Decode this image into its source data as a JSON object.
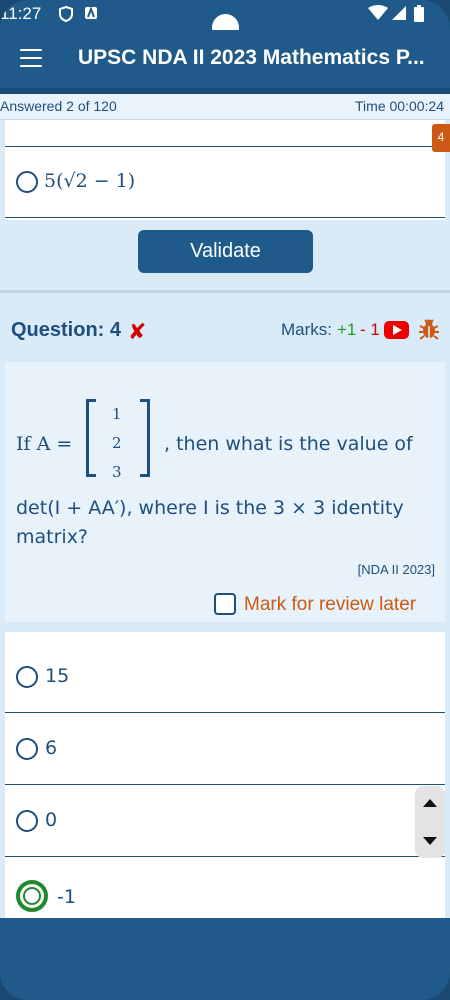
{
  "status": {
    "time": "11:27"
  },
  "appbar": {
    "title": "UPSC NDA II 2023 Mathematics P..."
  },
  "progress": {
    "answered": "Answered 2 of 120",
    "timer": "Time 00:00:24"
  },
  "previous_question": {
    "page_badge": "4",
    "last_option": "5(√2 − 1)",
    "validate_label": "Validate"
  },
  "question": {
    "label": "Question: 4",
    "marks_label": "Marks:",
    "marks_plus": "+1",
    "marks_minus": "- 1",
    "text_prefix": "If A =",
    "matrix": [
      "1",
      "2",
      "3"
    ],
    "text_suffix": ", then what is the value of",
    "line2": "det(I + AA′), where I is the 3 × 3 identity",
    "line3": "matrix?",
    "source": "[NDA II 2023]",
    "review_label": "Mark for review later"
  },
  "options": [
    {
      "label": "15",
      "selected": false
    },
    {
      "label": "6",
      "selected": false
    },
    {
      "label": "0",
      "selected": false
    },
    {
      "label": "-1",
      "selected": true
    }
  ],
  "colors": {
    "primary": "#1f5a8a",
    "text": "#1f4f7c",
    "accent": "#cc5a14",
    "wrong": "#d40000",
    "correct": "#2a9a2a"
  },
  "icons": {
    "menu": "hamburger-menu-icon",
    "wrong": "cross-mark-icon",
    "video": "youtube-play-icon",
    "report": "bug-icon"
  }
}
